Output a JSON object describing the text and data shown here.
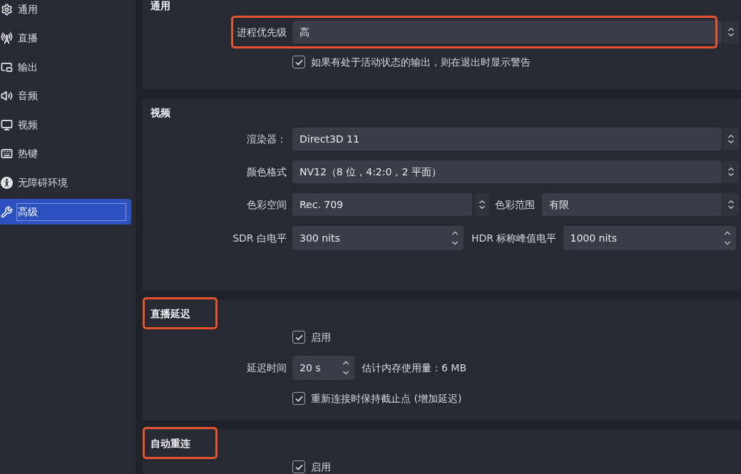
{
  "sidebar": {
    "items": [
      {
        "label": "通用",
        "selected": false
      },
      {
        "label": "直播",
        "selected": false
      },
      {
        "label": "输出",
        "selected": false
      },
      {
        "label": "音频",
        "selected": false
      },
      {
        "label": "视频",
        "selected": false
      },
      {
        "label": "热键",
        "selected": false
      },
      {
        "label": "无障碍环境",
        "selected": false
      },
      {
        "label": "高级",
        "selected": true
      }
    ]
  },
  "sections": [
    {
      "title": "通用",
      "highlighted": false,
      "rows": [
        {
          "kind": "select",
          "label": "进程优先级",
          "value": "高",
          "highlighted": true
        },
        {
          "kind": "checkbox",
          "label": "如果有处于活动状态的输出，则在退出时显示警告",
          "checked": true
        }
      ]
    },
    {
      "title": "视频",
      "highlighted": false,
      "rows": [
        {
          "kind": "select",
          "label": "渲染器：",
          "value": "Direct3D 11",
          "highlighted": false
        },
        {
          "kind": "select",
          "label": "颜色格式",
          "value": "NV12（8 位，4:2:0，2 平面）",
          "highlighted": false
        },
        {
          "kind": "select_pair",
          "fields": [
            {
              "label": "色彩空间",
              "value": "Rec. 709"
            },
            {
              "label": "色彩范围",
              "value": "有限"
            }
          ]
        },
        {
          "kind": "spin_pair",
          "fields": [
            {
              "label": "SDR 白电平",
              "value": "300 nits"
            },
            {
              "label": "HDR 标称峰值电平",
              "value": "1000 nits"
            }
          ]
        }
      ]
    },
    {
      "title": "直播延迟",
      "highlighted": true,
      "rows": [
        {
          "kind": "checkbox",
          "label": "启用",
          "checked": true
        },
        {
          "kind": "spin",
          "label": "延迟时间",
          "value": "20 s",
          "note": "估计内存使用量：6 MB"
        },
        {
          "kind": "checkbox",
          "label": "重新连接时保持截止点 (增加延迟)",
          "checked": true
        }
      ]
    },
    {
      "title": "自动重连",
      "highlighted": true,
      "rows": [
        {
          "kind": "checkbox",
          "label": "启用",
          "checked": true
        }
      ]
    }
  ]
}
